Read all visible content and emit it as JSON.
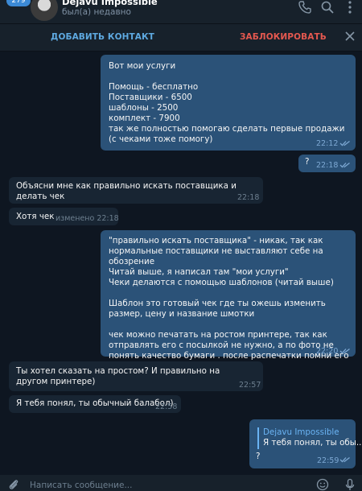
{
  "header": {
    "back_badge": "279",
    "chat_title": "Dejavu Impossible",
    "chat_status": "был(а) недавно"
  },
  "actionbar": {
    "add_contact": "ДОБАВИТЬ КОНТАКТ",
    "block": "ЗАБЛОКИРОВАТЬ"
  },
  "messages": [
    {
      "dir": "out",
      "text": "Вот мои услуги\n\nПомощь - бесплатно\nПоставщики - 6500\nшаблоны - 2500\nкомплект - 7900\nтак же полностью помогаю сделать первые продажи (с чеками тоже помогу)",
      "time": "22:12"
    },
    {
      "dir": "out",
      "text": "?",
      "time": "22:18"
    },
    {
      "dir": "in",
      "text": "Объясни мне как правильно искать поставщика и делать чек",
      "time": "22:18"
    },
    {
      "dir": "in",
      "text": "Хотя чек",
      "time": "изменено 22:18"
    },
    {
      "dir": "out",
      "text": "\"правильно искать поставщика\" - никак, так как нормальные поставщики не выставляют себе на обозрение\nЧитай выше, я написал там \"мои услуги\"\nЧеки делаются с помощью шаблонов (читай выше)\n\nШаблон это готовый чек где ты ожешь изменить размер, цену и название шмотки\n\nчек можно печатать на ростом принтере, так как отправлять его с посылкой не нужно, а по фото не понять качество бумаги . после распечатки помни его и всё, чек готов",
      "time": "22:20"
    },
    {
      "dir": "in",
      "text": "Ты хотел сказать на простом? И правильно на другом принтере)",
      "time": "22:57"
    },
    {
      "dir": "in",
      "text": "Я тебя понял, ты обычный балабол)",
      "time": "22:58"
    },
    {
      "dir": "out",
      "reply_name": "Dejavu Impossible",
      "reply_text": "Я тебя понял, ты обы...",
      "text": "?",
      "time": "22:59"
    }
  ],
  "composer": {
    "placeholder": "Написать сообщение..."
  },
  "colors": {
    "background": "#0e1621",
    "panel": "#17212b",
    "incoming": "#182533",
    "outgoing": "#2b5278",
    "accent": "#5ea9e0",
    "danger": "#e4584f"
  },
  "icons": [
    "phone-icon",
    "search-icon",
    "more-icon",
    "close-icon",
    "attach-icon",
    "emoji-icon",
    "mic-icon",
    "double-check-icon"
  ]
}
